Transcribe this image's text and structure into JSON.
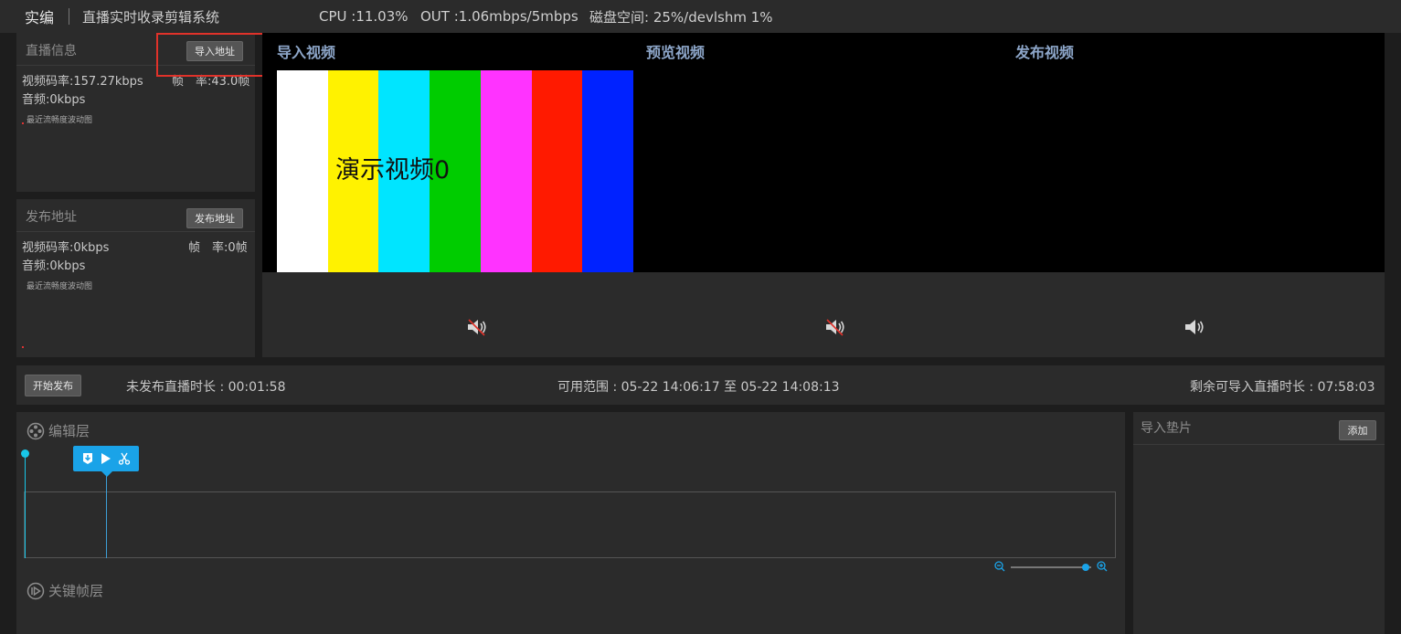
{
  "topbar": {
    "brand": "实编",
    "system_title": "直播实时收录剪辑系统",
    "cpu": "CPU :11.03%",
    "out": "OUT :1.06mbps/5mbps",
    "disk": "磁盘空间: 25%/devlshm 1%"
  },
  "live_info": {
    "title": "直播信息",
    "import_button": "导入地址",
    "video_bitrate": "视频码率:157.27kbps",
    "fps": "帧　率:43.0帧",
    "audio": "音频:0kbps",
    "chart_note": "最近流畅度波动图"
  },
  "publish_addr": {
    "title": "发布地址",
    "button": "发布地址",
    "video_bitrate": "视频码率:0kbps",
    "fps": "帧　率:0帧",
    "audio": "音频:0kbps",
    "chart_note": "最近流畅度波动图"
  },
  "video": {
    "import_label": "导入视频",
    "preview_label": "预览视频",
    "publish_label": "发布视频",
    "demo_text": "演示视频0",
    "colors": [
      "#ffffff",
      "#fff200",
      "#00e5ff",
      "#00cc00",
      "#ff33ff",
      "#ff1a00",
      "#0022ff"
    ]
  },
  "publish_bar": {
    "start_button": "开始发布",
    "unpublished": "未发布直播时长 : 00:01:58",
    "range": "可用范围 : 05-22 14:06:17 至 05-22 14:08:13",
    "remaining": "剩余可导入直播时长 : 07:58:03"
  },
  "timeline": {
    "edit_layer": "编辑层",
    "keyframe_layer": "关键帧层"
  },
  "pad": {
    "title": "导入垫片",
    "add_button": "添加"
  },
  "colors": {
    "accent": "#1aa3e8",
    "playhead": "#18c6e8",
    "highlight": "#e0322a",
    "label_blue": "#8da6c9"
  }
}
